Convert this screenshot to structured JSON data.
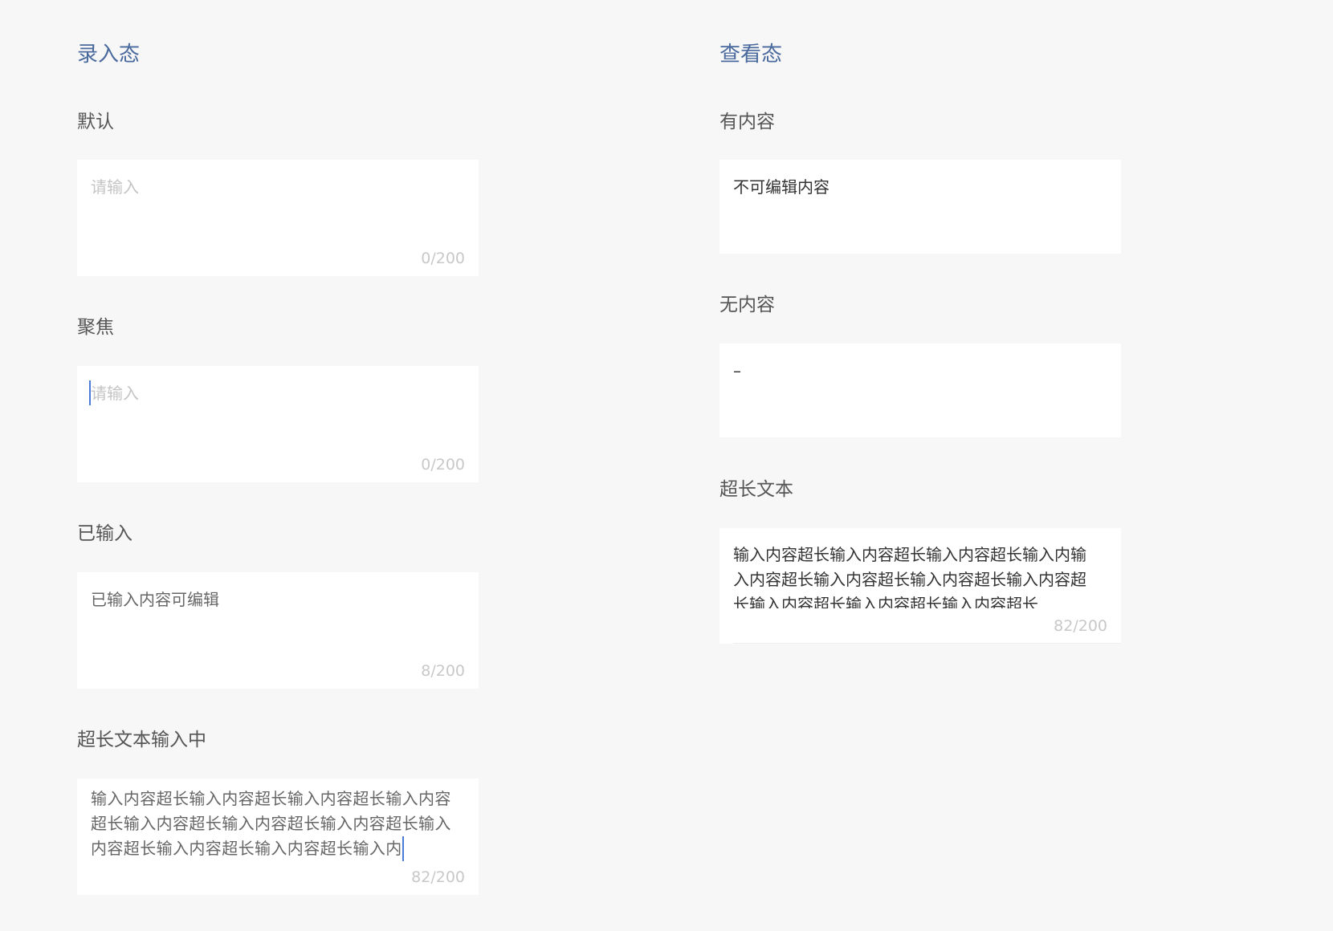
{
  "input_state": {
    "title": "录入态",
    "default": {
      "label": "默认",
      "placeholder": "请输入",
      "counter": "0/200"
    },
    "focused": {
      "label": "聚焦",
      "placeholder": "请输入",
      "counter": "0/200"
    },
    "entered": {
      "label": "已输入",
      "value": "已输入内容可编辑",
      "counter": "8/200"
    },
    "long_text": {
      "label": "超长文本输入中",
      "value": "输入内容超长输入内容超长输入内容超长输入内容超长输入内容超长输入内容超长输入内容超长输入内容超长输入内容超长输入内容超长输入内",
      "counter": "82/200"
    }
  },
  "view_state": {
    "title": "查看态",
    "with_content": {
      "label": "有内容",
      "value": "不可编辑内容"
    },
    "no_content": {
      "label": "无内容",
      "value": "–"
    },
    "long_text": {
      "label": "超长文本",
      "value": "输入内容超长输入内容超长输入内容超长输入内输入内容超长输入内容超长输入内容超长输入内容超长输入内容超长输入内容超长输入内容超长",
      "counter": "82/200"
    }
  },
  "colors": {
    "background": "#f7f7f7",
    "section_title": "#4a6a9e",
    "caret": "#4a7bd6"
  }
}
